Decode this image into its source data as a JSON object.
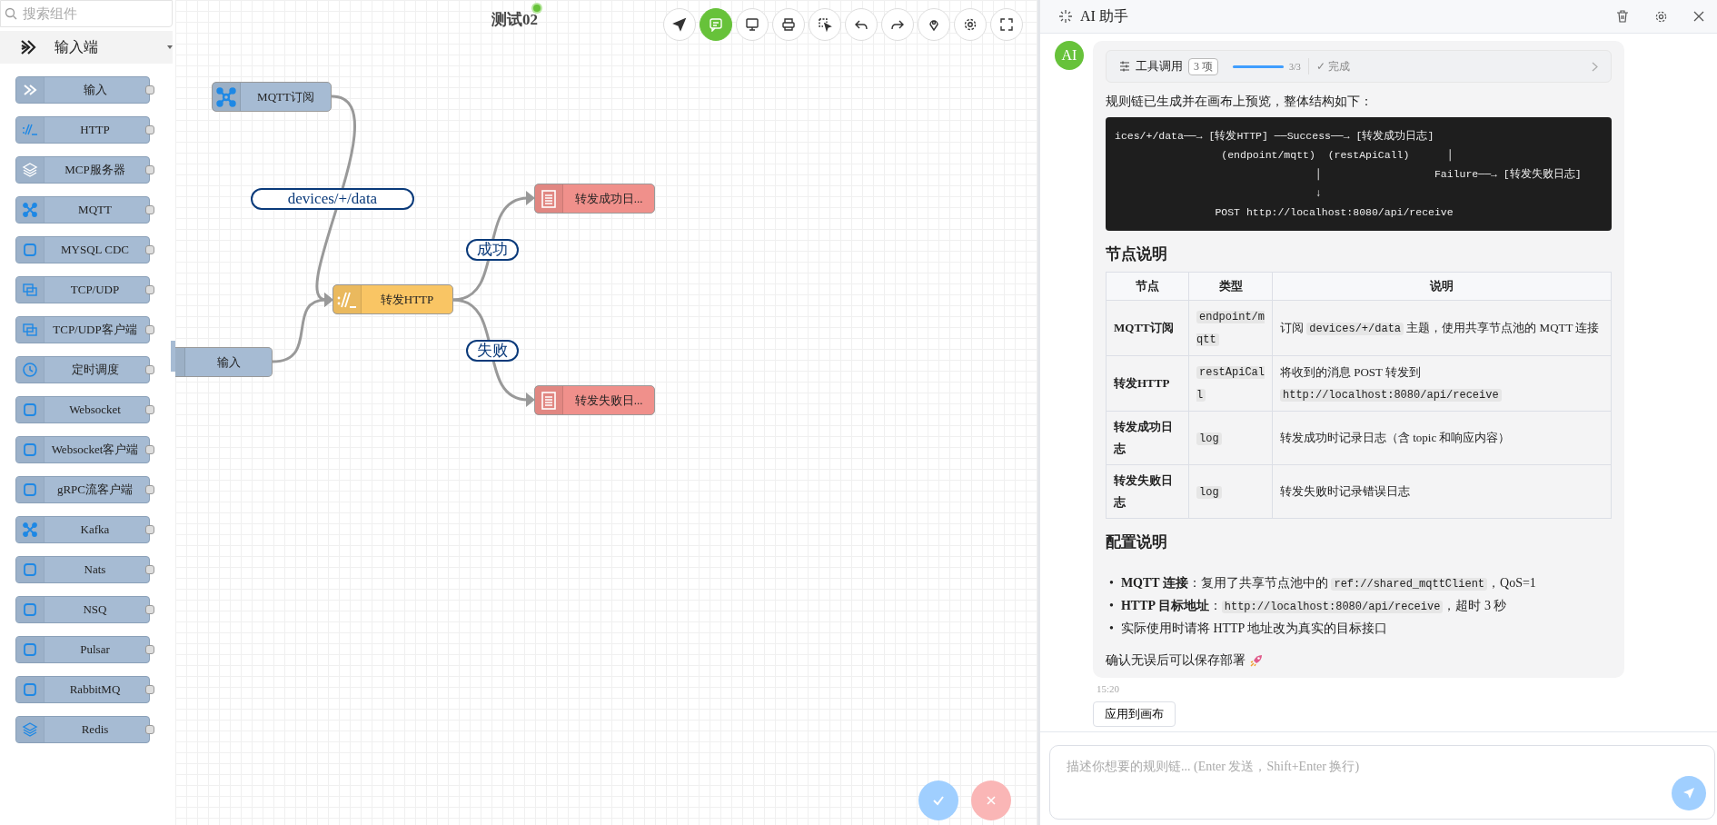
{
  "palette": {
    "search": {
      "placeholder": "搜索组件"
    },
    "category": {
      "label": "输入端",
      "expanded": true
    },
    "items": [
      {
        "label": "输入"
      },
      {
        "label": "HTTP"
      },
      {
        "label": "MCP服务器"
      },
      {
        "label": "MQTT"
      },
      {
        "label": "MYSQL CDC"
      },
      {
        "label": "TCP/UDP"
      },
      {
        "label": "TCP/UDP客户端"
      },
      {
        "label": "定时调度"
      },
      {
        "label": "Websocket"
      },
      {
        "label": "Websocket客户端"
      },
      {
        "label": "gRPC流客户端"
      },
      {
        "label": "Kafka"
      },
      {
        "label": "Nats"
      },
      {
        "label": "NSQ"
      },
      {
        "label": "Pulsar"
      },
      {
        "label": "RabbitMQ"
      },
      {
        "label": "Redis"
      }
    ]
  },
  "canvas": {
    "title": "测试02",
    "online": true,
    "toolbar": [
      {
        "selected": false
      },
      {
        "selected": true
      },
      {
        "selected": false
      },
      {
        "selected": false
      },
      {
        "selected": false
      },
      {
        "selected": false
      },
      {
        "selected": false
      },
      {
        "selected": false
      },
      {
        "selected": false
      },
      {
        "selected": false
      }
    ],
    "nodes": [
      {
        "label": "MQTT订阅",
        "kind": "input"
      },
      {
        "label": "转发HTTP",
        "kind": "action"
      },
      {
        "label": "输入",
        "kind": "input"
      },
      {
        "label": "转发成功日...",
        "kind": "output"
      },
      {
        "label": "转发失败日...",
        "kind": "output"
      }
    ],
    "edge_labels": [
      "devices/+/data",
      "成功",
      "失败"
    ]
  },
  "assistant": {
    "title": "AI 助手",
    "avatar": "AI",
    "tool_call": {
      "label": "工具调用",
      "count": "3 项",
      "level": 1,
      "progress": "3/3",
      "status": "✓ 完成"
    },
    "intro": "规则链已生成并在画布上预览，整体结构如下：",
    "code_lines": [
      "ices/+/data──→ [转发HTTP] ──Success──→ [转发成功日志]",
      "                 (endpoint/mqtt)  (restApiCall)      │",
      "                                │                  Failure──→ [转发失败日志]",
      "                                ↓",
      "                POST http://localhost:8080/api/receive"
    ],
    "nodes_heading": "节点说明",
    "table": {
      "columns": [
        "节点",
        "类型",
        "说明"
      ],
      "rows": [
        [
          [
            {
              "kind": "text",
              "text": "MQTT订阅"
            }
          ],
          [
            {
              "kind": "code",
              "text": "endpoint/mqtt"
            }
          ],
          [
            {
              "kind": "text",
              "text": "订阅 "
            },
            {
              "kind": "code",
              "text": "devices/+/data"
            },
            {
              "kind": "text",
              "text": " 主题，使用共享节点池的 MQTT 连接"
            }
          ]
        ],
        [
          [
            {
              "kind": "text",
              "text": "转发HTTP"
            }
          ],
          [
            {
              "kind": "code",
              "text": "restApiCall"
            }
          ],
          [
            {
              "kind": "text",
              "text": "将收到的消息 POST 转发到 "
            },
            {
              "kind": "code",
              "text": "http://localhost:8080/api/receive"
            }
          ]
        ],
        [
          [
            {
              "kind": "text",
              "text": "转发成功日志"
            }
          ],
          [
            {
              "kind": "code",
              "text": "log"
            }
          ],
          [
            {
              "kind": "text",
              "text": "转发成功时记录日志（含 topic 和响应内容）"
            }
          ]
        ],
        [
          [
            {
              "kind": "text",
              "text": "转发失败日志"
            }
          ],
          [
            {
              "kind": "code",
              "text": "log"
            }
          ],
          [
            {
              "kind": "text",
              "text": "转发失败时记录错误日志"
            }
          ]
        ]
      ]
    },
    "config_heading": "配置说明",
    "bullets": [
      {
        "marker": "•",
        "parts": [
          {
            "kind": "bold",
            "text": "MQTT 连接"
          },
          {
            "kind": "text",
            "text": "：复用了共享节点池中的 "
          },
          {
            "kind": "code",
            "text": "ref://shared_mqttClient"
          },
          {
            "kind": "text",
            "text": "，QoS=1"
          }
        ]
      },
      {
        "marker": "•",
        "parts": [
          {
            "kind": "bold",
            "text": "HTTP 目标地址"
          },
          {
            "kind": "text",
            "text": "："
          },
          {
            "kind": "code",
            "text": "http://localhost:8080/api/receive"
          },
          {
            "kind": "text",
            "text": "，超时 3 秒"
          }
        ]
      },
      {
        "marker": "•",
        "parts": [
          {
            "kind": "text",
            "text": "实际使用时请将 HTTP 地址改为真实的目标接口"
          }
        ]
      }
    ],
    "closing": "确认无误后可以保存部署",
    "time": "15:20",
    "apply_button": "应用到画布",
    "input": {
      "placeholder": "描述你想要的规则链... (Enter 发送，Shift+Enter 换行)"
    }
  }
}
